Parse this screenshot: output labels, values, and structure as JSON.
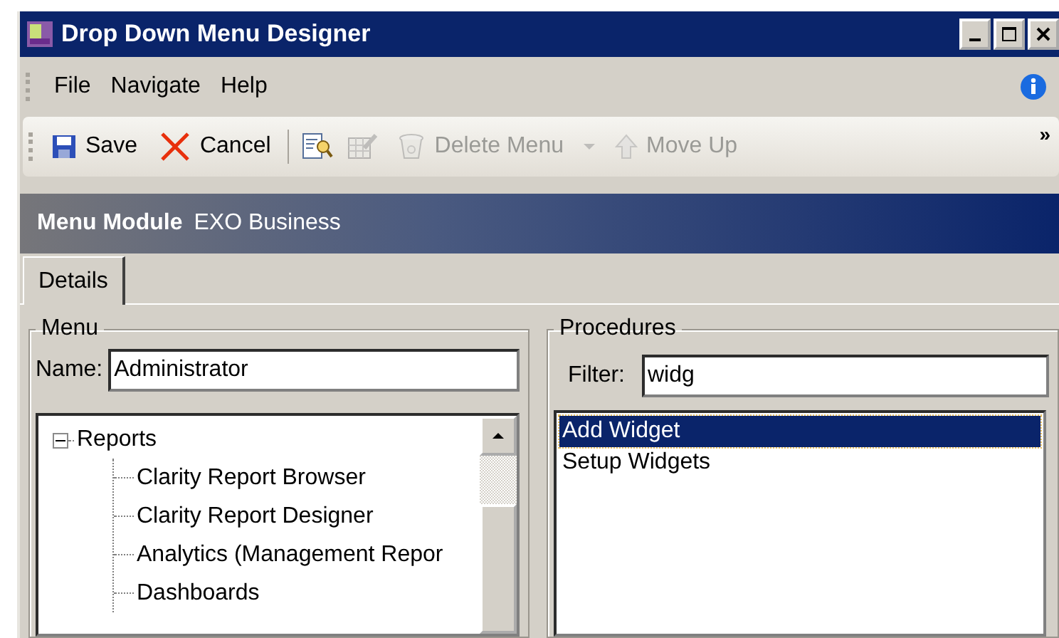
{
  "window": {
    "title": "Drop Down Menu Designer"
  },
  "menu_bar": [
    {
      "label": "File"
    },
    {
      "label": "Navigate"
    },
    {
      "label": "Help"
    }
  ],
  "toolbar": [
    {
      "kind": "save",
      "label": "Save",
      "disabled": false
    },
    {
      "kind": "cancel",
      "label": "Cancel",
      "disabled": false
    },
    {
      "kind": "separator"
    },
    {
      "kind": "find",
      "disabled": false
    },
    {
      "kind": "edit",
      "disabled": true
    },
    {
      "kind": "delete",
      "label": "Delete Menu",
      "disabled": true
    },
    {
      "kind": "dropdown",
      "disabled": true
    },
    {
      "kind": "move_up",
      "label": "Move Up",
      "disabled": true
    }
  ],
  "toolbar_overflow": "»",
  "header": {
    "title": "Menu Module",
    "subtitle": "EXO Business"
  },
  "tabs": [
    {
      "label": "Details",
      "selected": true
    }
  ],
  "menu_group": {
    "title": "Menu",
    "name_label": "Name:",
    "name_value": "Administrator",
    "tree": [
      {
        "label": "Reports",
        "expanded": true,
        "children": [
          {
            "label": "Clarity Report Browser"
          },
          {
            "label": "Clarity Report Designer"
          },
          {
            "label": "Analytics (Management Repor"
          },
          {
            "label": "Dashboards"
          }
        ]
      }
    ]
  },
  "procedures_group": {
    "title": "Procedures",
    "filter_label": "Filter:",
    "filter_value": "widg",
    "items": [
      {
        "label": "Add Widget",
        "selected": true
      },
      {
        "label": "Setup Widgets",
        "selected": false
      }
    ]
  }
}
